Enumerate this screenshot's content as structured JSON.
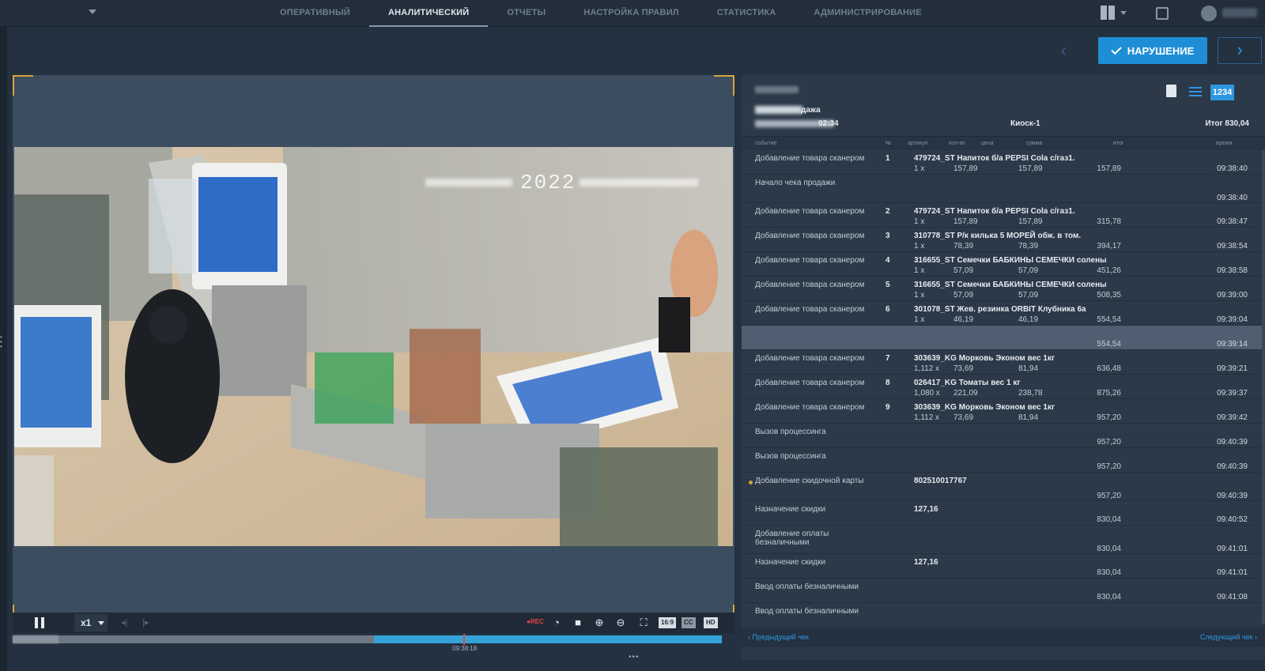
{
  "nav": {
    "items": [
      {
        "label": "ОПЕРАТИВНЫЙ",
        "active": false
      },
      {
        "label": "АНАЛИТИЧЕСКИЙ",
        "active": true
      },
      {
        "label": "ОТЧЕТЫ",
        "active": false
      },
      {
        "label": "НАСТРОЙКА ПРАВИЛ",
        "active": false
      },
      {
        "label": "СТАТИСТИКА",
        "active": false
      },
      {
        "label": "АДМИНИСТРИРОВАНИЕ",
        "active": false
      }
    ]
  },
  "toolbar": {
    "violation_label": "НАРУШЕНИЕ",
    "prev_arrow": "‹",
    "next_arrow": "›"
  },
  "video": {
    "timestamp_text": "2022"
  },
  "controls": {
    "speed": "x1",
    "rec": "●REC",
    "ratio": "16:9",
    "cc": "CC",
    "hd": "HD",
    "timeline_time": "09:38:18",
    "progress_fraction": 0.51
  },
  "receipt": {
    "title_suffix": "дажа",
    "time": "02:34",
    "kiosk": "Киоск-1",
    "total": "Итог 830,04",
    "view_number_icon": "1234",
    "columns": [
      "событие",
      "№",
      "артикул",
      "кол-во",
      "цена",
      "сумма",
      "итог",
      "время"
    ],
    "rows": [
      {
        "event": "Добавление товара сканером",
        "no": "1",
        "article": "479724_ST  Напиток б/а PEPSI Cola с/газ1.",
        "qty": "1 x",
        "price": "157,89",
        "sum": "157,89",
        "itog": "157,89",
        "time": "09:38:40",
        "h": 31
      },
      {
        "event": "Начало чека продажи",
        "no": "",
        "article": "",
        "qty": "",
        "price": "",
        "sum": "",
        "itog": "",
        "time": "09:38:40",
        "h": 36
      },
      {
        "event": "Добавление товара сканером",
        "no": "2",
        "article": "479724_ST  Напиток б/а PEPSI Cola с/газ1.",
        "qty": "1 x",
        "price": "157,89",
        "sum": "157,89",
        "itog": "315,78",
        "time": "09:38:47",
        "h": 31
      },
      {
        "event": "Добавление товара сканером",
        "no": "3",
        "article": "310778_ST  Р/к килька 5 МОРЕЙ обж. в том.",
        "qty": "1 x",
        "price": "78,39",
        "sum": "78,39",
        "itog": "394,17",
        "time": "09:38:54",
        "h": 31
      },
      {
        "event": "Добавление товара сканером",
        "no": "4",
        "article": "316655_ST  Семечки БАБКИНЫ СЕМЕЧКИ солены",
        "qty": "1 x",
        "price": "57,09",
        "sum": "57,09",
        "itog": "451,26",
        "time": "09:38:58",
        "h": 31
      },
      {
        "event": "Добавление товара сканером",
        "no": "5",
        "article": "316655_ST  Семечки БАБКИНЫ СЕМЕЧКИ солены",
        "qty": "1 x",
        "price": "57,09",
        "sum": "57,09",
        "itog": "508,35",
        "time": "09:39:00",
        "h": 31
      },
      {
        "event": "Добавление товара сканером",
        "no": "6",
        "article": "301078_ST  Жев. резинка ORBIT Клубника 6а",
        "qty": "1 x",
        "price": "46,19",
        "sum": "46,19",
        "itog": "554,54",
        "time": "09:39:04",
        "h": 31
      },
      {
        "event": "",
        "no": "",
        "article": "",
        "qty": "",
        "price": "",
        "sum": "",
        "itog": "554,54",
        "time": "09:39:14",
        "h": 31,
        "highlight": true
      },
      {
        "event": "Добавление товара сканером",
        "no": "7",
        "article": "303639_KG  Морковь Эконом вес 1кг",
        "qty": "1,112 x",
        "price": "73,69",
        "sum": "81,94",
        "itog": "636,48",
        "time": "09:39:21",
        "h": 31
      },
      {
        "event": "Добавление товара сканером",
        "no": "8",
        "article": "026417_KG  Томаты вес 1 кг",
        "qty": "1,080 x",
        "price": "221,09",
        "sum": "238,78",
        "itog": "875,26",
        "time": "09:39:37",
        "h": 31
      },
      {
        "event": "Добавление товара сканером",
        "no": "9",
        "article": "303639_KG  Морковь Эконом вес 1кг",
        "qty": "1,112 x",
        "price": "73,69",
        "sum": "81,94",
        "itog": "957,20",
        "time": "09:39:42",
        "h": 31
      },
      {
        "event": "Вызов процессинга",
        "no": "",
        "article": "",
        "qty": "",
        "price": "",
        "sum": "",
        "itog": "957,20",
        "time": "09:40:39",
        "h": 31
      },
      {
        "event": "Вызов процессинга",
        "no": "",
        "article": "",
        "qty": "",
        "price": "",
        "sum": "",
        "itog": "957,20",
        "time": "09:40:39",
        "h": 31
      },
      {
        "event": "Добавление скидочной карты",
        "no": "",
        "article": "802510017767",
        "qty": "",
        "price": "",
        "sum": "",
        "itog": "957,20",
        "time": "09:40:39",
        "h": 36,
        "dot": true
      },
      {
        "event": "Назначение скидки",
        "no": "",
        "article": "127,16",
        "qty": "",
        "price": "",
        "sum": "",
        "itog": "830,04",
        "time": "09:40:52",
        "h": 31
      },
      {
        "event": "Добавление оплаты безналичными",
        "no": "",
        "article": "",
        "qty": "",
        "price": "",
        "sum": "",
        "itog": "830,04",
        "time": "09:41:01",
        "h": 36
      },
      {
        "event": "Назначение скидки",
        "no": "",
        "article": "127,16",
        "qty": "",
        "price": "",
        "sum": "",
        "itog": "830,04",
        "time": "09:41:01",
        "h": 31
      },
      {
        "event": "Ввод оплаты безналичными",
        "no": "",
        "article": "",
        "qty": "",
        "price": "",
        "sum": "",
        "itog": "830,04",
        "time": "09:41:08",
        "h": 31
      },
      {
        "event": "Ввод оплаты безналичными",
        "no": "",
        "article": "",
        "qty": "",
        "price": "",
        "sum": "",
        "itog": "",
        "time": "",
        "h": 31
      }
    ],
    "prev_check": "Предыдущий чек",
    "next_check": "Следующий чек"
  }
}
